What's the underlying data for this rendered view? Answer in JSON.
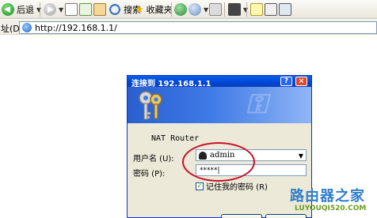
{
  "toolbar": {
    "back_label": "后退",
    "search_label": "搜索",
    "favorites_label": "收藏夹"
  },
  "address": {
    "label": "址(D)",
    "url": "http://192.168.1.1/"
  },
  "dialog": {
    "title": "连接到 192.168.1.1",
    "help_label": "?",
    "close_label": "×",
    "realm_text": "NAT Router",
    "username_label": "用户名 (U):",
    "password_label": "密码 (P):",
    "username_value": "admin",
    "password_value": "*****|",
    "remember_label": "记住我的密码 (R)",
    "remember_checked": "✓"
  },
  "watermark": {
    "brand": "路由器之家",
    "url": "LUYOUQI520.COM"
  }
}
